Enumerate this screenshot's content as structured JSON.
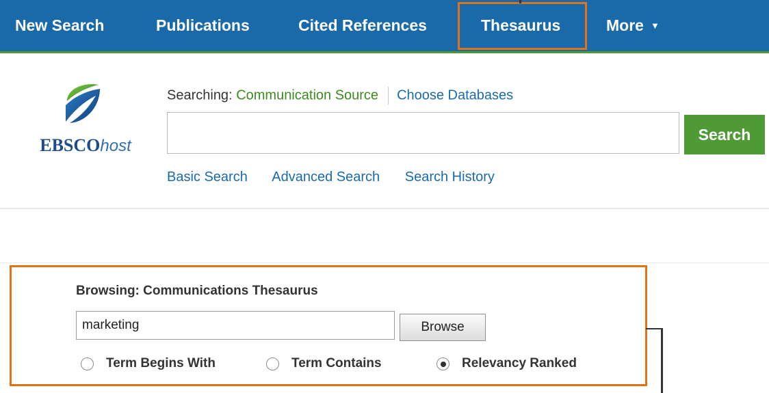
{
  "nav": {
    "items": [
      {
        "label": "New Search"
      },
      {
        "label": "Publications"
      },
      {
        "label": "Cited References"
      },
      {
        "label": "Thesaurus"
      },
      {
        "label": "More"
      }
    ],
    "more_caret": "▼"
  },
  "logo": {
    "text_bold": "EBSCO",
    "text_italic": "host"
  },
  "search": {
    "searching_label": "Searching:",
    "database": "Communication Source",
    "choose_databases": "Choose Databases",
    "query": "",
    "button": "Search",
    "links": [
      "Basic Search",
      "Advanced Search",
      "Search History"
    ]
  },
  "browse": {
    "title": "Browsing: Communications Thesaurus",
    "term": "marketing",
    "button": "Browse",
    "options": [
      {
        "label": "Term Begins With",
        "checked": false
      },
      {
        "label": "Term Contains",
        "checked": false
      },
      {
        "label": "Relevancy Ranked",
        "checked": true
      }
    ]
  },
  "colors": {
    "nav_bg": "#1a6aaa",
    "accent_green": "#4f9a35",
    "callout_orange": "#e0731a",
    "link_blue": "#1a6aaa"
  }
}
